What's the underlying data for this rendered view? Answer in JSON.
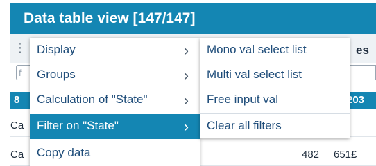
{
  "window": {
    "title": "Data table view [147/147]"
  },
  "grid": {
    "toolbar_trail": "es",
    "filter_hint": "f",
    "header_col1": "8",
    "header_col_last": "203",
    "rows": [
      {
        "col1": "Ca",
        "col2": "",
        "col3": "£"
      },
      {
        "col1": "Ca",
        "col2": "482",
        "col3": "651£"
      }
    ]
  },
  "context_menu": {
    "items": [
      {
        "label": "Display",
        "has_submenu": true
      },
      {
        "label": "Groups",
        "has_submenu": true
      },
      {
        "label": "Calculation of \"State\"",
        "has_submenu": true
      },
      {
        "label": "Filter on \"State\"",
        "has_submenu": true,
        "active": true
      },
      {
        "label": "Copy data",
        "has_submenu": false
      }
    ]
  },
  "submenu": {
    "items": [
      {
        "label": "Mono val select list"
      },
      {
        "label": "Multi val select list"
      },
      {
        "label": "Free input val"
      },
      {
        "label": "Clear all filters"
      }
    ]
  },
  "icons": {
    "submenu_arrow": "chevron-right-icon",
    "drag_handle": "drag-dots-icon"
  },
  "colors": {
    "accent": "#1486b3",
    "menu_text": "#1f4d7a"
  }
}
